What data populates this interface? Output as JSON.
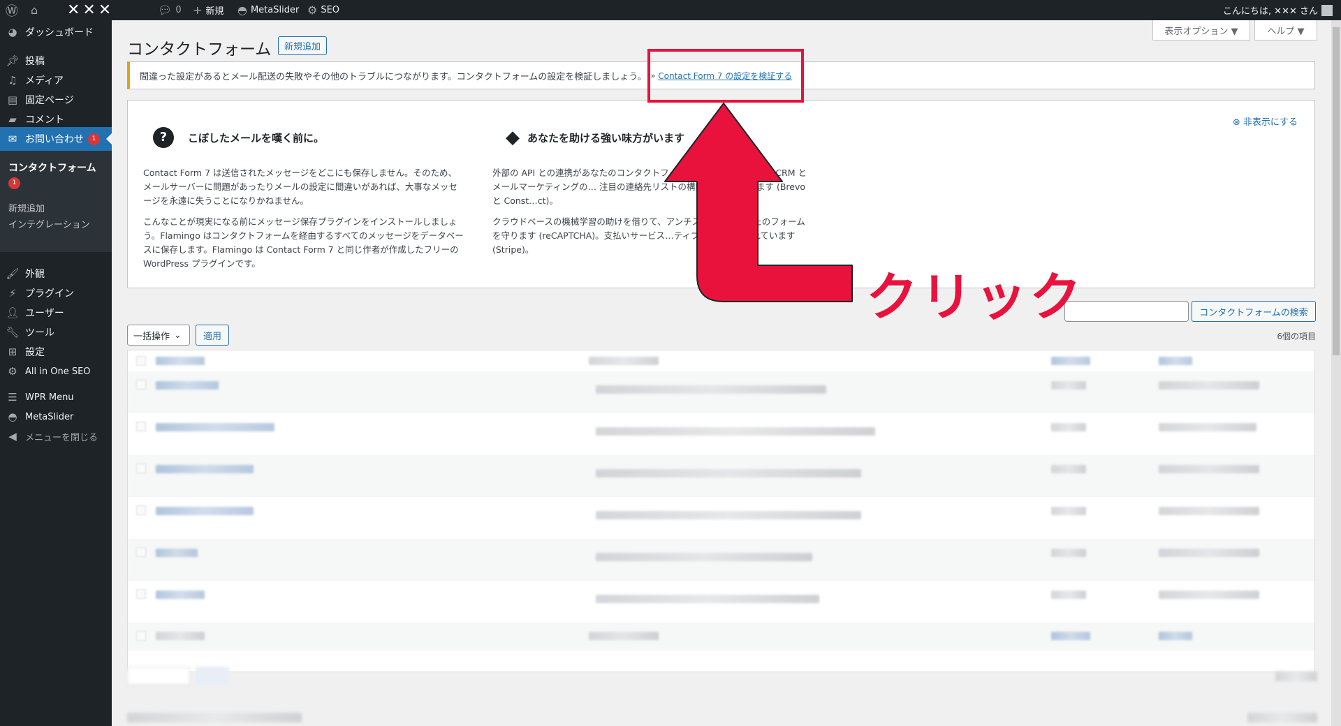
{
  "adminbar": {
    "site_name": "✕✕✕",
    "comments_count": "0",
    "new_label": "新規",
    "metaslider_label": "MetaSlider",
    "seo_label": "SEO",
    "greeting": "こんにちは, ✕✕✕ さん"
  },
  "sidebar": {
    "items": [
      {
        "label": "ダッシュボード",
        "icon": "dashboard-icon"
      },
      {
        "label": "投稿",
        "icon": "pin-icon"
      },
      {
        "label": "メディア",
        "icon": "media-icon"
      },
      {
        "label": "固定ページ",
        "icon": "page-icon"
      },
      {
        "label": "コメント",
        "icon": "comment-icon"
      },
      {
        "label": "お問い合わせ",
        "icon": "mail-icon",
        "badge": "1"
      },
      {
        "label": "外観",
        "icon": "brush-icon"
      },
      {
        "label": "プラグイン",
        "icon": "plugin-icon"
      },
      {
        "label": "ユーザー",
        "icon": "user-icon"
      },
      {
        "label": "ツール",
        "icon": "wrench-icon"
      },
      {
        "label": "設定",
        "icon": "settings-icon"
      },
      {
        "label": "All in One SEO",
        "icon": "aioseo-icon"
      },
      {
        "label": "WPR Menu",
        "icon": "menu-icon"
      },
      {
        "label": "MetaSlider",
        "icon": "metaslider-icon"
      },
      {
        "label": "メニューを閉じる",
        "icon": "collapse-icon"
      }
    ],
    "submenu": {
      "current": "コンタクトフォーム",
      "current_badge": "1",
      "add_new": "新規追加",
      "integration": "インテグレーション"
    }
  },
  "header": {
    "screen_options": "表示オプション ▼",
    "help": "ヘルプ ▼",
    "title": "コンタクトフォーム",
    "add_new": "新規追加"
  },
  "notice": {
    "text": "間違った設定があるとメール配送の失敗やその他のトラブルにつながります。コンタクトフォームの設定を検証しましょう。",
    "sep": "»",
    "link": "Contact Form 7 の設定を検証する"
  },
  "welcome": {
    "dismiss": "非表示にする",
    "col1": {
      "title": "こぼしたメールを嘆く前に。",
      "p1": "Contact Form 7 は送信されたメッセージをどこにも保存しません。そのため、メールサーバーに問題があったりメールの設定に間違いがあれば、大事なメッセージを永遠に失うことになりかねません。",
      "p2": "こんなことが現実になる前にメッセージ保存プラグインをインストールしましょう。Flamingo はコンタクトフォームを経由するすべてのメッセージをデータベースに保存します。Flamingo は Contact Form 7 と同じ作者が作成したフリーの WordPress プラグインです。"
    },
    "col2": {
      "title": "あなたを助ける強い味方がいます",
      "p1": "外部の API との連携があなたのコンタクトフォ… 機能なものにします。CRM とメールマーケティングの… 注目の連絡先リストの構築が可能になります (Brevo と Const…ct)。",
      "p2": "クラウドベースの機械学習の助けを借りて、アンチス…ビスはあなたのフォームを守ります (reCAPTCHA)。支払いサービス…ティブでサポートされています (Stripe)。"
    }
  },
  "search": {
    "button": "コンタクトフォームの検索"
  },
  "toolbar": {
    "bulk": "一括操作",
    "apply": "適用",
    "count": "6個の項目"
  },
  "annotation": {
    "text": "クリック",
    "color": "#e8123c"
  }
}
